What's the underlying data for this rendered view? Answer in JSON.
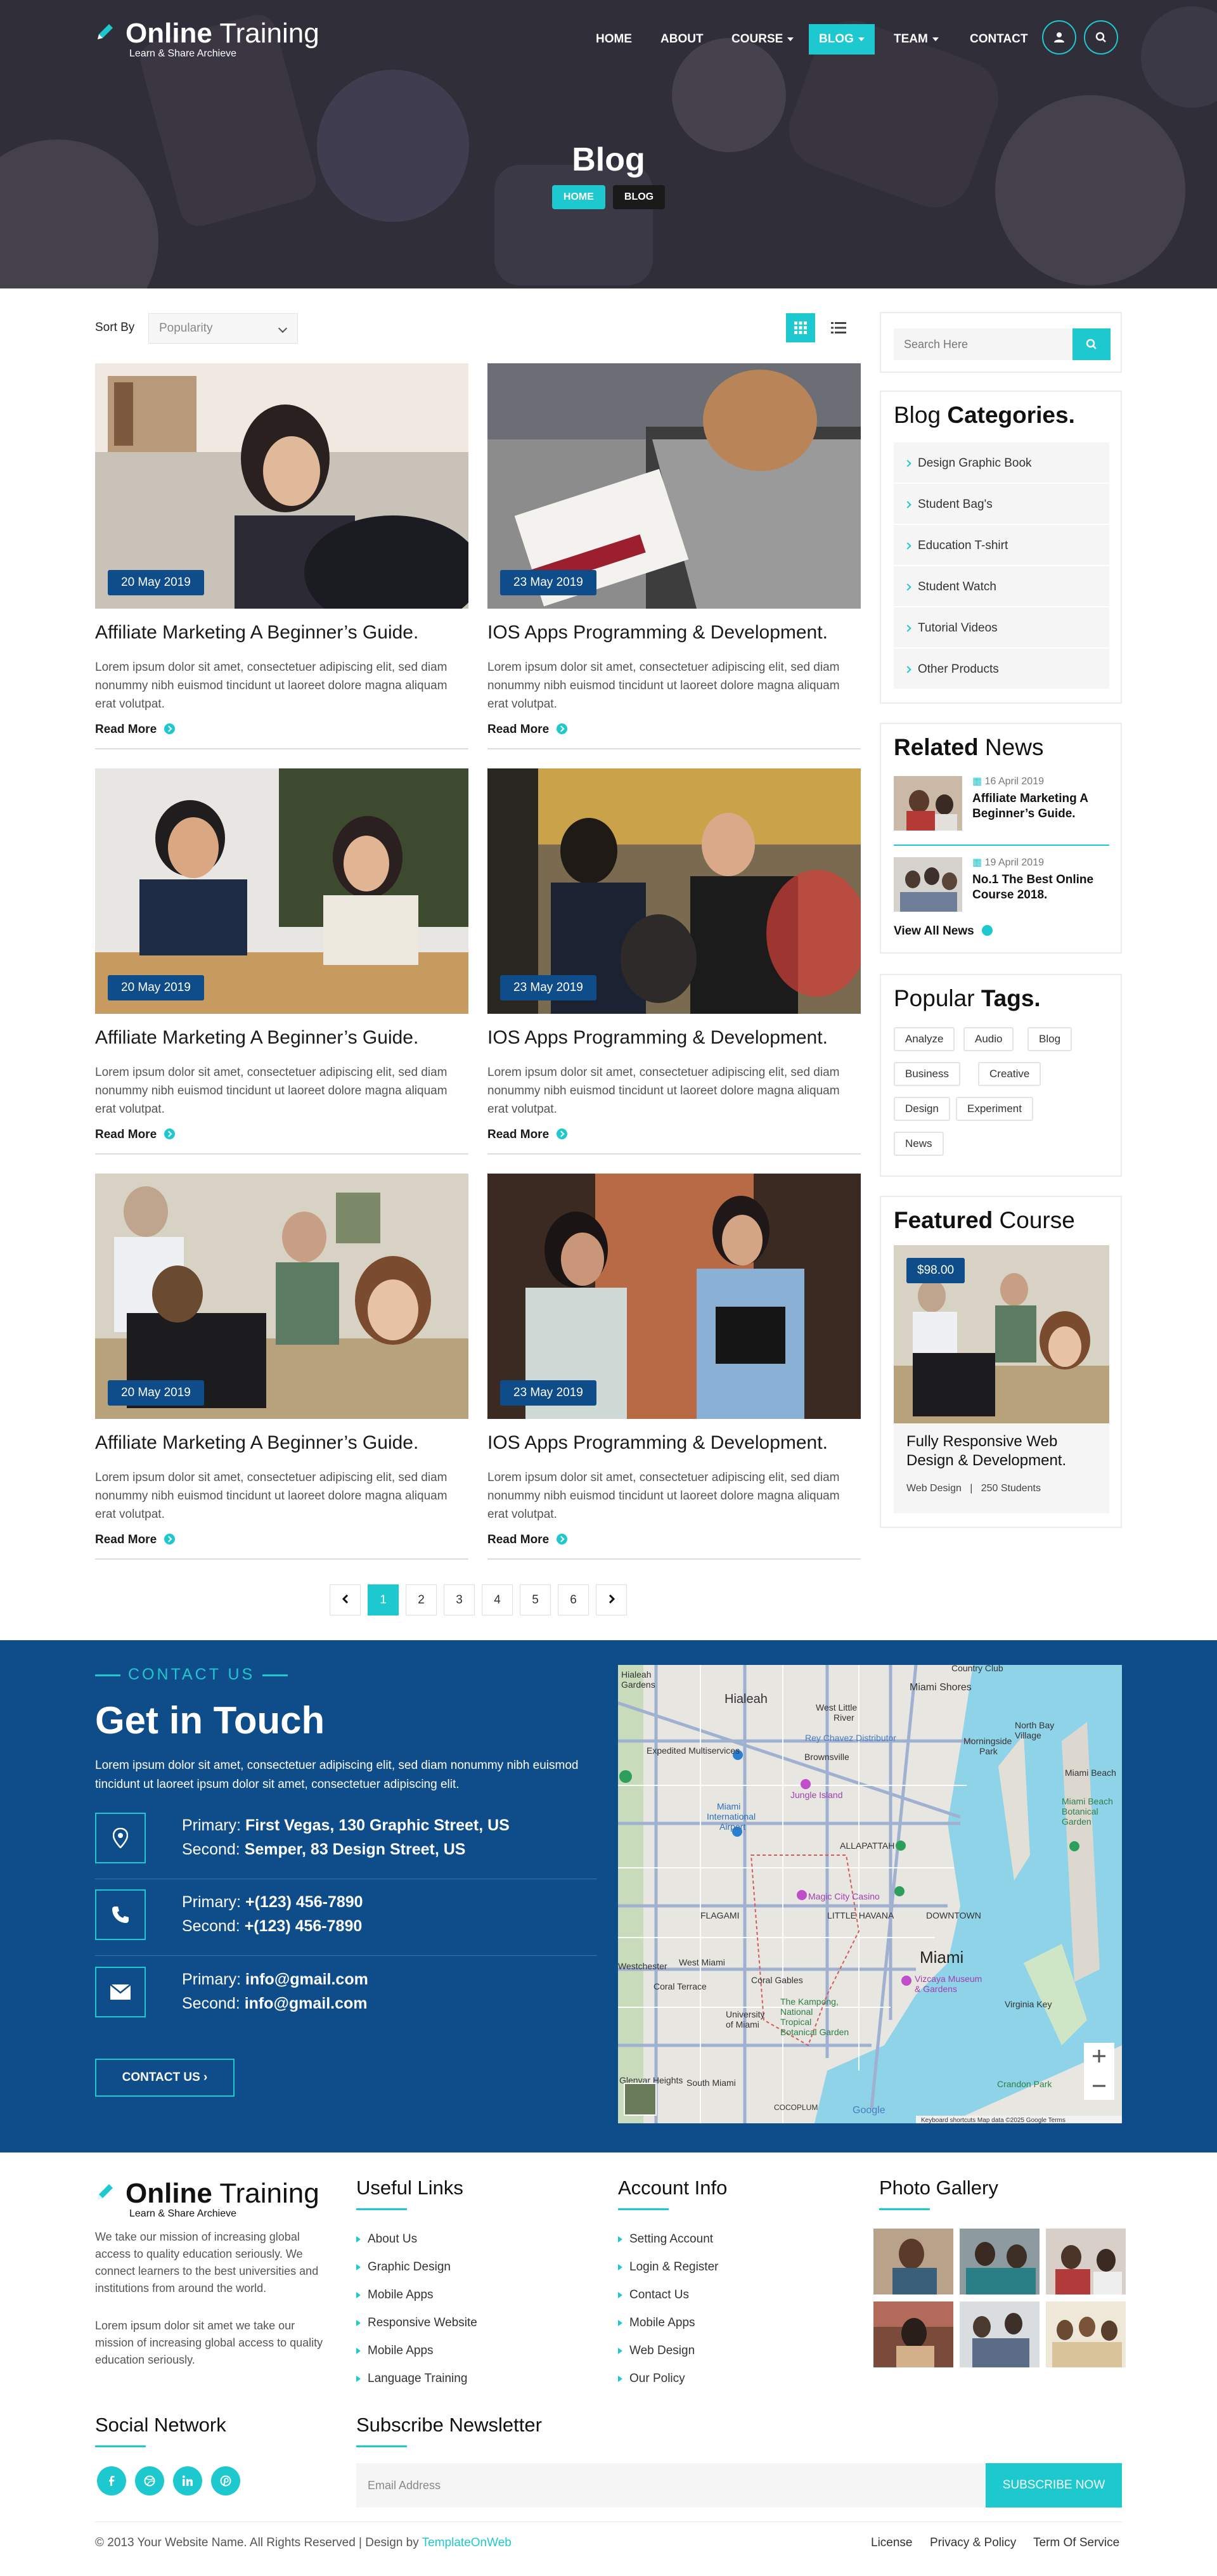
{
  "brand": {
    "name_bold": "Online",
    "name_rest": " Training",
    "tagline": "Learn & Share Archieve"
  },
  "nav": {
    "items": [
      "HOME",
      "ABOUT",
      "COURSE",
      "BLOG",
      "TEAM",
      "CONTACT"
    ],
    "active": "BLOG"
  },
  "hero": {
    "title": "Blog",
    "crumb_home": "HOME",
    "crumb_current": "BLOG"
  },
  "sort": {
    "label": "Sort By",
    "value": "Popularity"
  },
  "posts": [
    {
      "date": "20 May 2019",
      "title": "Affiliate Marketing A Beginner’s Guide.",
      "excerpt": "Lorem ipsum dolor sit amet, consectetuer adipiscing elit, sed diam nonummy nibh euismod tincidunt ut laoreet dolore magna aliquam erat volutpat.",
      "more": "Read More"
    },
    {
      "date": "23 May 2019",
      "title": "IOS Apps Programming & Development.",
      "excerpt": "Lorem ipsum dolor sit amet, consectetuer adipiscing elit, sed diam nonummy nibh euismod tincidunt ut laoreet dolore magna aliquam erat volutpat.",
      "more": "Read More"
    },
    {
      "date": "20 May 2019",
      "title": "Affiliate Marketing A Beginner’s Guide.",
      "excerpt": "Lorem ipsum dolor sit amet, consectetuer adipiscing elit, sed diam nonummy nibh euismod tincidunt ut laoreet dolore magna aliquam erat volutpat.",
      "more": "Read More"
    },
    {
      "date": "23 May 2019",
      "title": "IOS Apps Programming & Development.",
      "excerpt": "Lorem ipsum dolor sit amet, consectetuer adipiscing elit, sed diam nonummy nibh euismod tincidunt ut laoreet dolore magna aliquam erat volutpat.",
      "more": "Read More"
    },
    {
      "date": "20 May 2019",
      "title": "Affiliate Marketing A Beginner’s Guide.",
      "excerpt": "Lorem ipsum dolor sit amet, consectetuer adipiscing elit, sed diam nonummy nibh euismod tincidunt ut laoreet dolore magna aliquam erat volutpat.",
      "more": "Read More"
    },
    {
      "date": "23 May 2019",
      "title": "IOS Apps Programming & Development.",
      "excerpt": "Lorem ipsum dolor sit amet, consectetuer adipiscing elit, sed diam nonummy nibh euismod tincidunt ut laoreet dolore magna aliquam erat volutpat.",
      "more": "Read More"
    }
  ],
  "pagination": {
    "pages": [
      "1",
      "2",
      "3",
      "4",
      "5",
      "6"
    ],
    "active": "1"
  },
  "sidebar": {
    "search_placeholder": "Search Here",
    "categories_title_plain": "Blog ",
    "categories_title_bold": "Categories.",
    "categories": [
      "Design Graphic Book",
      "Student Bag's",
      "Education T-shirt",
      "Student Watch",
      "Tutorial Videos",
      "Other Products"
    ],
    "related_title_bold": "Related",
    "related_title_plain": " News",
    "related": [
      {
        "date": "16 April 2019",
        "title": "Affiliate Marketing A Beginner’s Guide."
      },
      {
        "date": "19 April 2019",
        "title": "No.1 The Best Online Course 2018."
      }
    ],
    "view_all": "View All News",
    "tags_title_plain": "Popular ",
    "tags_title_bold": "Tags.",
    "tags": [
      "Analyze",
      "Audio",
      "Blog",
      "Business",
      "Creative",
      "Design",
      "Experiment",
      "News"
    ],
    "featured_title_bold": "Featured",
    "featured_title_plain": " Course",
    "featured": {
      "price": "$98.00",
      "title": "Fully Responsive Web Design & Development.",
      "category": "Web Design",
      "students": "250 Students"
    }
  },
  "contact": {
    "kicker": "CONTACT US",
    "title": "Get in Touch",
    "desc": "Lorem ipsum dolor sit amet, consectetuer adipiscing elit, sed diam nonummy nibh euismod tincidunt ut laoreet ipsum dolor sit amet, consectetuer adipiscing elit.",
    "address": {
      "p_label": "Primary: ",
      "p_value": "First Vegas, 130 Graphic Street, US",
      "s_label": "Second: ",
      "s_value": "Semper, 83 Design Street, US"
    },
    "phone": {
      "p_label": "Primary: ",
      "p_value": "+(123) 456-7890",
      "s_label": "Second: ",
      "s_value": "+(123) 456-7890"
    },
    "email": {
      "p_label": "Primary: ",
      "p_value": "info@gmail.com",
      "s_label": "Second: ",
      "s_value": "info@gmail.com"
    },
    "button": "CONTACT US"
  },
  "map": {
    "labels": [
      "Hialeah Gardens",
      "Hialeah",
      "Country Club",
      "Miami Shores",
      "West Little River",
      "North Bay Village",
      "Morningside Park",
      "Miami Beach",
      "Brownsville",
      "Miami International Airport",
      "Rey Chavez Distributor",
      "Expedited Multiservices",
      "Jungle Island",
      "Miami Beach Botanical Garden",
      "ALLAPATTAH",
      "Magic City Casino",
      "LITTLE HAVANA",
      "FLAGAMI",
      "DOWNTOWN",
      "West Miami",
      "Coral Terrace",
      "Miami",
      "Coral Gables",
      "Vizcaya Museum & Gardens",
      "Virginia Key",
      "The Kampong, National Tropical Botanical Garden",
      "University of Miami",
      "South Miami",
      "Crandon Park",
      "COCOPLUM",
      "Glenvar Heights",
      "Westchester"
    ],
    "attribution": "Google",
    "footer_text": "Keyboard shortcuts    Map data ©2025 Google    Terms"
  },
  "footer": {
    "about_p1": "We take our mission of increasing global access to quality education seriously. We connect learners to the best universities and institutions from around the world.",
    "about_p2": "Lorem ipsum dolor sit amet we take our mission of increasing global access to quality education seriously.",
    "useful_title": "Useful Links",
    "useful": [
      "About Us",
      "Graphic Design",
      "Mobile Apps",
      "Responsive Website",
      "Mobile Apps",
      "Language Training"
    ],
    "account_title": "Account Info",
    "account": [
      "Setting Account",
      "Login & Register",
      "Contact Us",
      "Mobile Apps",
      "Web Design",
      "Our Policy"
    ],
    "gallery_title": "Photo Gallery",
    "social_title": "Social Network",
    "newsletter_title": "Subscribe Newsletter",
    "newsletter_placeholder": "Email Address",
    "newsletter_button": "SUBSCRIBE NOW",
    "copyright_prefix": "© 2013 Your Website Name. All Rights Reserved | Design by ",
    "copyright_link": "TemplateOnWeb",
    "bottom_links": [
      "License",
      "Privacy & Policy",
      "Term Of Service"
    ]
  },
  "colors": {
    "accent": "#1ec8cf",
    "navy": "#0e4c8a",
    "dark": "#1a1a1a"
  }
}
